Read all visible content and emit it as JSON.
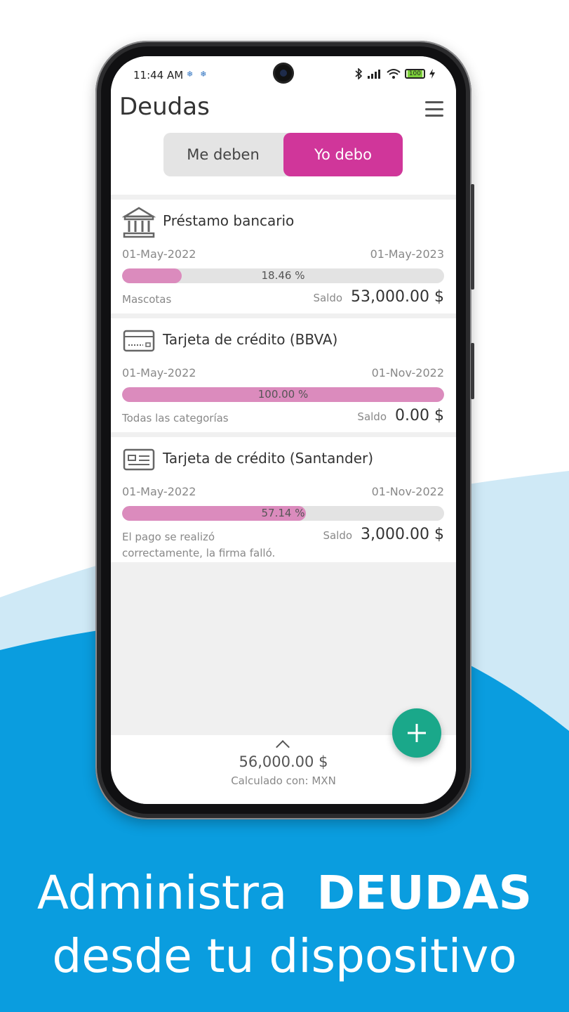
{
  "status": {
    "time": "11:44 AM",
    "battery": "100"
  },
  "header": {
    "title": "Deudas",
    "toggle": {
      "left_label": "Me deben",
      "right_label": "Yo debo",
      "selected": "Yo debo"
    }
  },
  "debts": [
    {
      "name": "Préstamo bancario",
      "icon": "bank-icon",
      "start_date": "01-May-2022",
      "end_date": "01-May-2023",
      "progress_text": "18.46 %",
      "progress": 18.46,
      "category": "Mascotas",
      "balance_label": "Saldo",
      "balance": "53,000.00 $"
    },
    {
      "name": "Tarjeta de crédito (BBVA)",
      "icon": "credit-card-icon",
      "start_date": "01-May-2022",
      "end_date": "01-Nov-2022",
      "progress_text": "100.00 %",
      "progress": 100,
      "category": "Todas las categorías",
      "balance_label": "Saldo",
      "balance": "0.00 $"
    },
    {
      "name": "Tarjeta de crédito (Santander)",
      "icon": "id-card-icon",
      "start_date": "01-May-2022",
      "end_date": "01-Nov-2022",
      "progress_text": "57.14 %",
      "progress": 57.14,
      "category": "El pago se realizó correctamente, la firma falló.",
      "balance_label": "Saldo",
      "balance": "3,000.00 $"
    }
  ],
  "footer": {
    "total": "56,000.00 $",
    "calculated_with": "Calculado con: MXN"
  },
  "colors": {
    "accent": "#d0369a",
    "progress_fill": "#db8bbd",
    "fab": "#1aa88a",
    "wave_light": "#cfe9f6",
    "wave_dark": "#0a9ddf"
  },
  "promo": {
    "line1_normal": "Administra",
    "line1_bold": "DEUDAS",
    "line2": "desde tu dispositivo"
  }
}
